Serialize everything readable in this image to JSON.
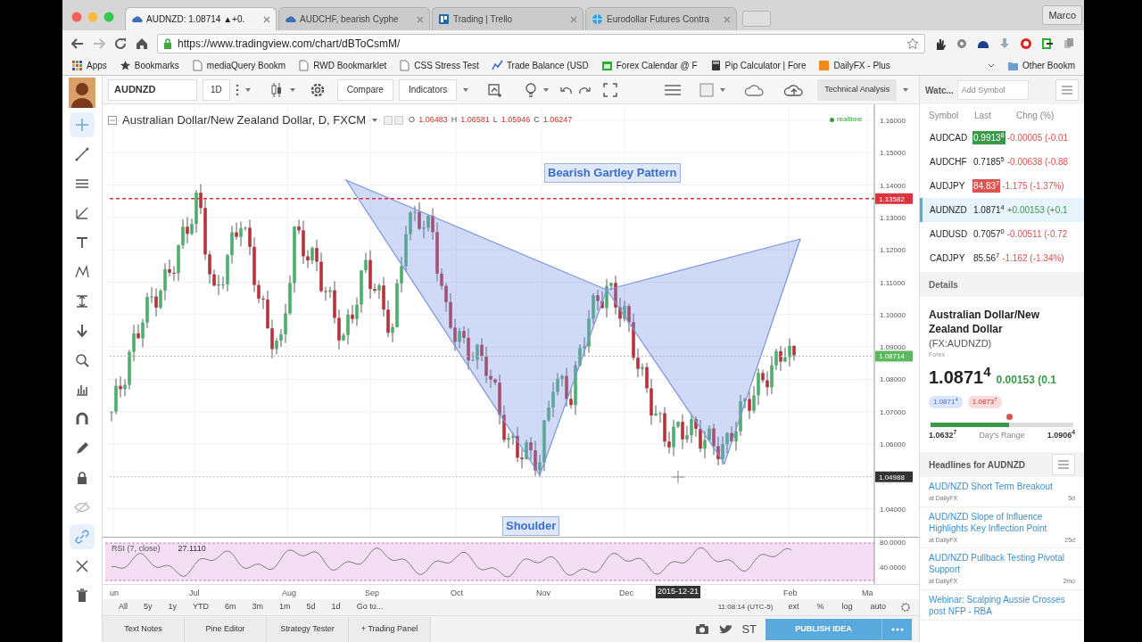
{
  "browser": {
    "tabs": [
      {
        "title": "AUDNZD: 1.08714 ▲+0.",
        "selected": true
      },
      {
        "title": "AUDCHF, bearish Cyphe",
        "selected": false
      },
      {
        "title": "Trading | Trello",
        "selected": false
      },
      {
        "title": "Eurodollar Futures Contra",
        "selected": false
      }
    ],
    "profile": "Marco",
    "url": "https://www.tradingview.com/chart/dBToCsmM/",
    "bookmarks": [
      {
        "label": "Apps",
        "kind": "apps"
      },
      {
        "label": "Bookmarks",
        "kind": "star"
      },
      {
        "label": "mediaQuery Bookm",
        "kind": "page"
      },
      {
        "label": "RWD Bookmarklet",
        "kind": "page"
      },
      {
        "label": "CSS Stress Test",
        "kind": "page"
      },
      {
        "label": "Trade Balance (USD",
        "kind": "chart"
      },
      {
        "label": "Forex Calendar @ F",
        "kind": "calendar"
      },
      {
        "label": "Pip Calculator | Fore",
        "kind": "calc"
      },
      {
        "label": "DailyFX - Plus",
        "kind": "brand"
      },
      {
        "label": "Other Bookm",
        "kind": "folder"
      }
    ]
  },
  "toolbar": {
    "symbol": "AUDNZD",
    "interval": "1D",
    "compare": "Compare",
    "indicators": "Indicators",
    "layout": "Technical Analysis"
  },
  "chart": {
    "title": "Australian Dollar/New Zealand Dollar, D, FXCM",
    "ohlc": [
      {
        "label": "O",
        "value": "1.06483"
      },
      {
        "label": "H",
        "value": "1.06581"
      },
      {
        "label": "L",
        "value": "1.05946"
      },
      {
        "label": "C",
        "value": "1.06247"
      }
    ],
    "status": "realtime",
    "annotations": [
      {
        "text": "Bearish Gartley Pattern"
      },
      {
        "text": "Shoulder"
      }
    ],
    "price_ticks": [
      "1.16000",
      "1.15000",
      "1.14000",
      "1.13000",
      "1.12000",
      "1.11000",
      "1.10000",
      "1.09000",
      "1.08000",
      "1.07000",
      "1.06000",
      "1.04000"
    ],
    "price_tags": [
      {
        "value": "1.13582",
        "kind": "alert"
      },
      {
        "value": "1.08714",
        "kind": "last"
      },
      {
        "value": "1.04988",
        "kind": "cursor"
      }
    ],
    "time_ticks": [
      "un",
      "Jul",
      "Aug",
      "Sep",
      "Oct",
      "Nov",
      "Dec",
      "Feb",
      "Ma"
    ],
    "crosshair_date": "2015-12-21"
  },
  "rsi": {
    "label": "RSI (7, close)",
    "value": "27.1110",
    "ticks": [
      "80.0000",
      "40.0000"
    ]
  },
  "ranges": [
    "All",
    "5y",
    "1y",
    "YTD",
    "6m",
    "3m",
    "1m",
    "5d",
    "1d",
    "Go to..."
  ],
  "clock": "11:08:14 (UTC-5)",
  "scale_options": [
    "ext",
    "%",
    "log",
    "auto"
  ],
  "bottom_tabs": [
    "Text Notes",
    "Pine Editor",
    "Strategy Tester",
    "+ Trading Panel"
  ],
  "share": "ST",
  "publish": "PUBLISH IDEA",
  "watchlist": {
    "title": "Watc...",
    "placeholder": "Add Symbol",
    "columns": [
      "Symbol",
      "Last",
      "Chng (%)"
    ],
    "rows": [
      {
        "symbol": "AUDCAD",
        "last": "0.9913$^{8}$",
        "change": "-0.00005 (-0.01",
        "rising": false,
        "flashed": true,
        "flash_rising": true,
        "selected": false
      },
      {
        "symbol": "AUDCHF",
        "last": "0.7185$^{5}$",
        "change": "-0.00638 (-0.88",
        "rising": false,
        "flashed": false,
        "selected": false
      },
      {
        "symbol": "AUDJPY",
        "last": "84.83$^{7}$",
        "change": "-1.175 (-1.37%)",
        "rising": false,
        "flashed": true,
        "flash_rising": false,
        "selected": false
      },
      {
        "symbol": "AUDNZD",
        "last": "1.0871$^{4}$",
        "change": "+0.00153 (+0.1",
        "rising": true,
        "flashed": false,
        "selected": true
      },
      {
        "symbol": "AUDUSD",
        "last": "0.7057$^{0}$",
        "change": "-0.00511 (-0.72",
        "rising": false,
        "flashed": false,
        "selected": false
      },
      {
        "symbol": "CADJPY",
        "last": "85.56$^{7}$",
        "change": "-1.162 (-1.34%)",
        "rising": false,
        "flashed": false,
        "selected": false
      }
    ]
  },
  "details": {
    "heading": "Details",
    "name": "**Australian Dollar/New Zealand Dollar** (FX:AUDNZD)",
    "type": "Forex",
    "price": "1.0871$^{4}$",
    "change": "0.00153 (0.1",
    "bid": "1.0871$^{4}$",
    "ask": "1.0873$^{7}$",
    "range": {
      "level": 0.55,
      "low": "1.0632$^{7}$",
      "label": "Day's Range",
      "high": "1.0906$^{4}$"
    }
  },
  "headlines": {
    "title": "Headlines for AUDNZD",
    "items": [
      {
        "title": "AUD/NZD Short Term Breakout",
        "source": "at DailyFX",
        "age": "5d"
      },
      {
        "title": "AUD/NZD Slope of Influence Highlights Key Inflection Point",
        "source": "at DailyFX",
        "age": "25d"
      },
      {
        "title": "AUD/NZD Pullback Testing Pivotal Support",
        "source": "at DailyFX",
        "age": "2mo"
      },
      {
        "title": "Webinar: Scalping Aussie Crosses post NFP - RBA"
      }
    ]
  }
}
